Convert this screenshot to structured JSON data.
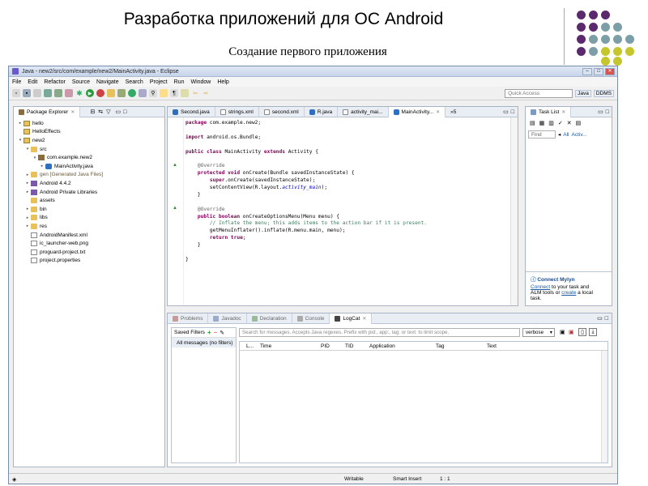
{
  "slide": {
    "title": "Разработка приложений для ОС Android",
    "subtitle": "Создание первого приложения",
    "dot_colors": [
      "#5b2a6e",
      "#7c9ea6",
      "#c5c62e"
    ]
  },
  "window": {
    "title": "Java - new2/src/com/example/new2/MainActivity.java - Eclipse",
    "menu": [
      "File",
      "Edit",
      "Refactor",
      "Source",
      "Navigate",
      "Search",
      "Project",
      "Run",
      "Window",
      "Help"
    ],
    "quick_access": "Quick Access",
    "perspectives": [
      "Java",
      "DDMS"
    ]
  },
  "package_explorer": {
    "title": "Package Explorer",
    "tree": [
      {
        "label": "hello",
        "icon": "project",
        "twisty": "▸"
      },
      {
        "label": "HelloEffects",
        "icon": "project",
        "twisty": ""
      },
      {
        "label": "new2",
        "icon": "project",
        "twisty": "▾"
      },
      {
        "label": "src",
        "icon": "folder",
        "twisty": "▾"
      },
      {
        "label": "com.example.new2",
        "icon": "package",
        "twisty": "▾"
      },
      {
        "label": "MainActivity.java",
        "icon": "java",
        "twisty": "▸"
      },
      {
        "label": "gen [Generated Java Files]",
        "icon": "folder",
        "twisty": "▸"
      },
      {
        "label": "Android 4.4.2",
        "icon": "library",
        "twisty": "▸"
      },
      {
        "label": "Android Private Libraries",
        "icon": "library",
        "twisty": "▸"
      },
      {
        "label": "assets",
        "icon": "folder",
        "twisty": ""
      },
      {
        "label": "bin",
        "icon": "folder",
        "twisty": "▸"
      },
      {
        "label": "libs",
        "icon": "folder",
        "twisty": "▸"
      },
      {
        "label": "res",
        "icon": "folder",
        "twisty": "▸"
      },
      {
        "label": "AndroidManifest.xml",
        "icon": "file",
        "twisty": ""
      },
      {
        "label": "ic_launcher-web.png",
        "icon": "file",
        "twisty": ""
      },
      {
        "label": "proguard-project.txt",
        "icon": "file",
        "twisty": ""
      },
      {
        "label": "project.properties",
        "icon": "file",
        "twisty": ""
      }
    ]
  },
  "editor": {
    "tabs": [
      "Second.java",
      "strings.xml",
      "second.xml",
      "R.java",
      "activity_mai...",
      "MainActivity...",
      "»5"
    ],
    "code": [
      "package com.example.new2;",
      "",
      "import android.os.Bundle;",
      "",
      "public class MainActivity extends Activity {",
      "",
      "    @Override",
      "    protected void onCreate(Bundle savedInstanceState) {",
      "        super.onCreate(savedInstanceState);",
      "        setContentView(R.layout.activity_main);",
      "    }",
      "",
      "    @Override",
      "    public boolean onCreateOptionsMenu(Menu menu) {",
      "        // Inflate the menu; this adds items to the action bar if it is present.",
      "        getMenuInflater().inflate(R.menu.main, menu);",
      "        return true;",
      "    }",
      "",
      "}"
    ]
  },
  "task_list": {
    "title": "Task List",
    "find_placeholder": "Find",
    "all": "All",
    "activate": "Activ...",
    "mylyn_title": "Connect Mylyn",
    "mylyn_connect": "Connect",
    "mylyn_text1": " to your task and",
    "mylyn_text2": "ALM tools or ",
    "mylyn_create": "create",
    "mylyn_text3": " a local",
    "mylyn_text4": "task."
  },
  "bottom_panel": {
    "tabs": [
      "Problems",
      "Javadoc",
      "Declaration",
      "Console",
      "LogCat"
    ],
    "saved_filters": "Saved Filters",
    "all_messages": "All messages (no filters)",
    "search_placeholder": "Search for messages. Accepts Java regexes. Prefix with pid:, app:, tag: or text: to limit scope.",
    "level": "verbose",
    "columns": [
      "L...",
      "Time",
      "PID",
      "TID",
      "Application",
      "Tag",
      "Text"
    ]
  },
  "status": {
    "writable": "Writable",
    "insert_mode": "Smart Insert",
    "position": "1 : 1"
  }
}
